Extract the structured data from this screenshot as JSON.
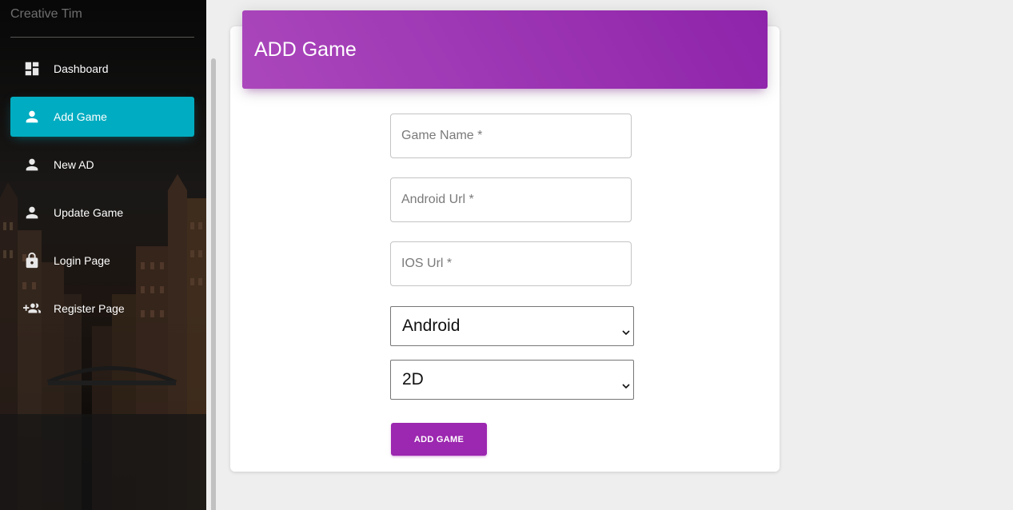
{
  "sidebar": {
    "brand": "Creative Tim",
    "items": [
      {
        "label": "Dashboard",
        "icon": "dashboard-icon",
        "active": false
      },
      {
        "label": "Add Game",
        "icon": "person-icon",
        "active": true
      },
      {
        "label": "New AD",
        "icon": "person-icon",
        "active": false
      },
      {
        "label": "Update Game",
        "icon": "person-icon",
        "active": false
      },
      {
        "label": "Login Page",
        "icon": "lock-icon",
        "active": false
      },
      {
        "label": "Register Page",
        "icon": "group-add-icon",
        "active": false
      }
    ]
  },
  "form": {
    "title": "ADD Game",
    "game_name_placeholder": "Game Name *",
    "android_url_placeholder": "Android Url *",
    "ios_url_placeholder": "IOS Url *",
    "platform_selected": "Android",
    "dimension_selected": "2D",
    "submit_label": "ADD GAME"
  },
  "colors": {
    "active_nav": "#00acc1",
    "header_gradient_start": "#ab47bc",
    "header_gradient_end": "#8e24aa",
    "button": "#9c27b0"
  }
}
